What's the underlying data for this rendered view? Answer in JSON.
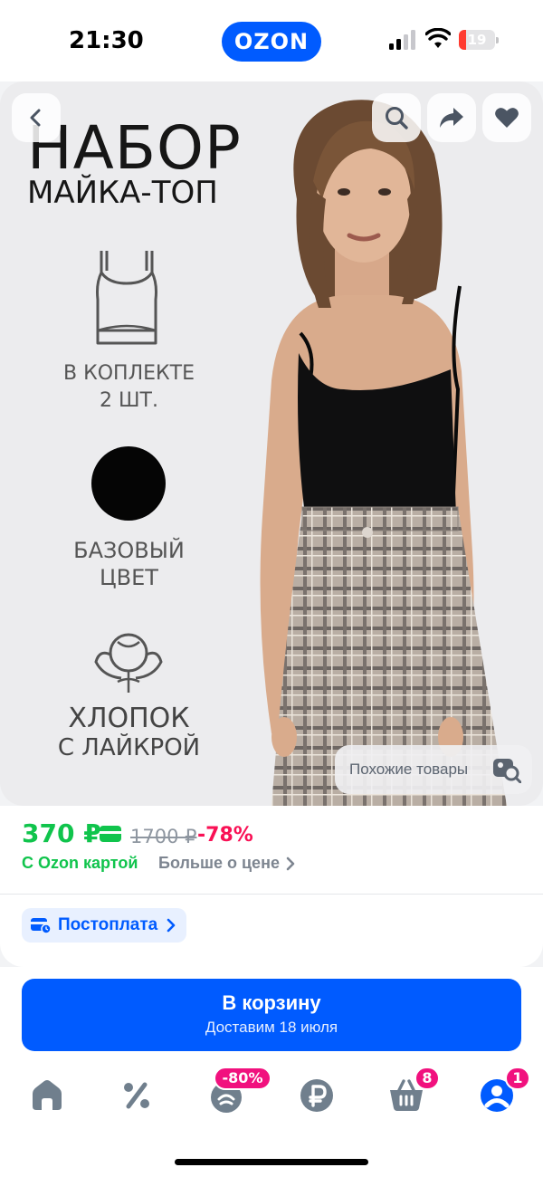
{
  "status_bar": {
    "time": "21:30",
    "app_logo": "OZON",
    "battery_percent": "19",
    "battery_level": 0.19,
    "icons": [
      "cellular-signal-icon",
      "wifi-icon",
      "battery-icon"
    ]
  },
  "gallery": {
    "nav_icons": [
      "back-arrow-icon",
      "search-icon",
      "share-icon",
      "heart-icon"
    ],
    "promo": {
      "title": "НАБОР",
      "subtitle": "МАЙКА-ТОП",
      "set_line1": "В КОПЛЕКТЕ",
      "set_line2": "2 ШТ.",
      "color_line1": "БАЗОВЫЙ",
      "color_line2": "ЦВЕТ",
      "material_line1": "ХЛОПОК",
      "material_line2": "С ЛАЙКРОЙ"
    },
    "similar_button": "Похожие товары"
  },
  "price": {
    "current": "370 ₽",
    "old": "1700 ₽",
    "discount": "-78%",
    "ozon_card_label": "С Ozon картой",
    "more_about_price": "Больше о цене",
    "accent_green": "#10c44c",
    "discount_color": "#f91155"
  },
  "postpay": {
    "label": "Постоплата"
  },
  "cart_button": {
    "label": "В корзину",
    "delivery": "Доставим 18 июля",
    "color": "#005bff"
  },
  "tab_bar": {
    "tabs": [
      {
        "icon": "home-icon"
      },
      {
        "icon": "percent-icon"
      },
      {
        "icon": "fresh-icon",
        "badge": "-80%"
      },
      {
        "icon": "ruble-icon"
      },
      {
        "icon": "cart-icon",
        "badge": "8"
      },
      {
        "icon": "profile-icon",
        "badge": "1"
      }
    ]
  }
}
